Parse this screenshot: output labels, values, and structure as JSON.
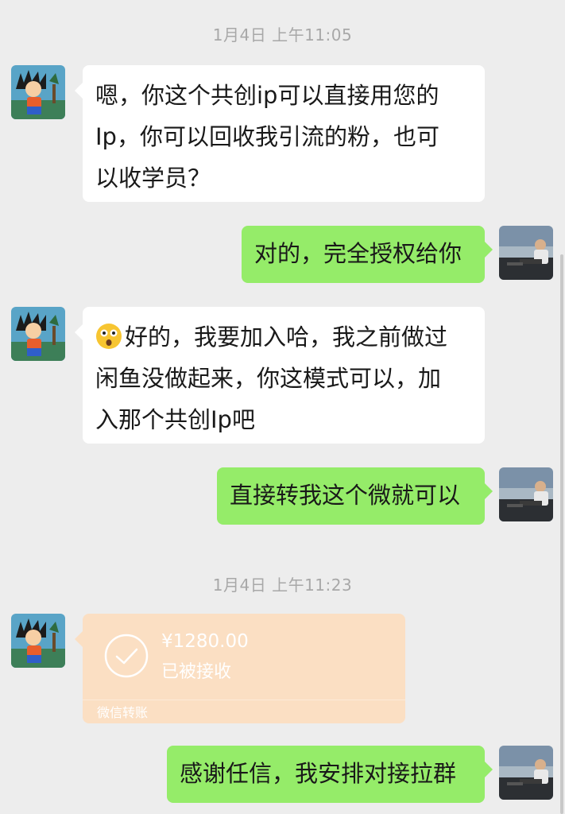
{
  "timestamps": [
    "1月4日 上午11:05",
    "1月4日 上午11:23"
  ],
  "messages": [
    {
      "side": "left",
      "lines": [
        "嗯，你这个共创ip可以直接用您的",
        "Ip，你可以回收我引流的粉，也可",
        "以收学员？"
      ]
    },
    {
      "side": "right",
      "text": "对的，完全授权给你"
    },
    {
      "side": "left",
      "emoji": "astonished-face-icon",
      "lines": [
        "好的，我要加入哈，我之前做过",
        "闲鱼没做起来，你这模式可以，加",
        "入那个共创Ip吧"
      ]
    },
    {
      "side": "right",
      "text": "直接转我这个微就可以"
    },
    {
      "side": "right",
      "text": "感谢任信，我安排对接拉群"
    }
  ],
  "transfer": {
    "amount": "¥1280.00",
    "status": "已被接收",
    "footer": "微信转账",
    "icon": "check-circle-icon"
  },
  "colors": {
    "background": "#ededed",
    "incoming_bubble": "#ffffff",
    "outgoing_bubble": "#95ec69",
    "transfer_card": "#fbdfc3",
    "timestamp_text": "#a8a8a8"
  }
}
